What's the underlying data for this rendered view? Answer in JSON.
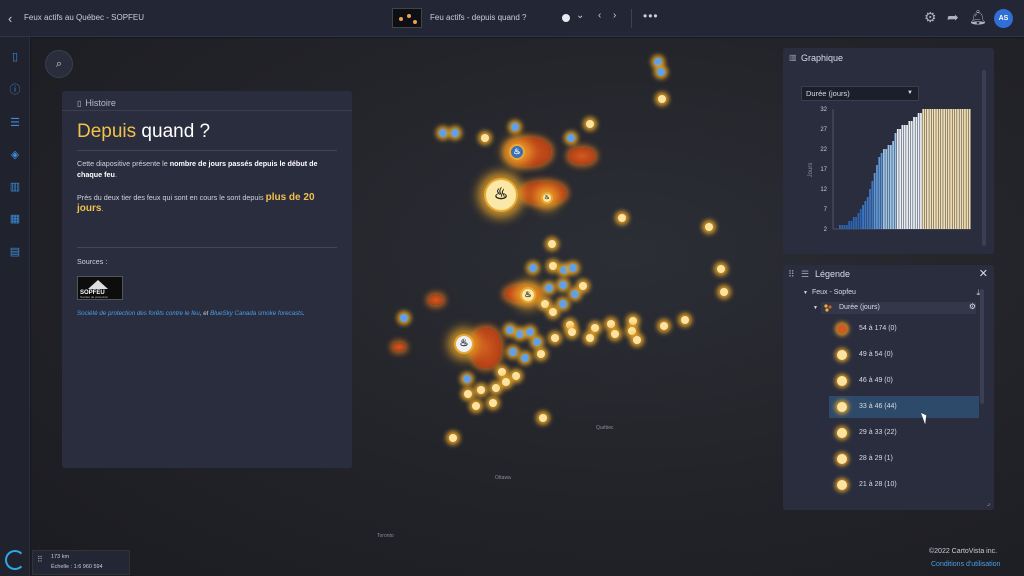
{
  "topbar": {
    "back_icon": "chevron-left-icon",
    "app_title": "Feux actifs au Québec - SOPFEU",
    "slide_title": "Feu actifs - depuis quand ?",
    "more_label": "•••",
    "avatar_initials": "AS"
  },
  "sidebar": {
    "items": [
      "map-icon",
      "info-icon",
      "list-icon",
      "layers-icon",
      "chart-icon",
      "table-icon",
      "book-icon"
    ]
  },
  "story": {
    "header": "Histoire",
    "title_accent": "Depuis",
    "title_rest": " quand ?",
    "p1_a": "Cette diapositive présente le ",
    "p1_b": "nombre de jours passés depuis le début de chaque feu",
    "p1_c": ".",
    "p2_a": "Près du deux tier des feux qui sont en cours le sont depuis ",
    "p2_b": "plus de 20 jours",
    "p2_c": ".",
    "sources_label": "Sources :",
    "logo_text": "SOPFEU",
    "logo_sub": "Société de protection",
    "src_link1": "Société de protection des forêts contre le feu",
    "src_mid": ", et ",
    "src_link2": "BlueSky Canada smoke forecasts",
    "src_end": "."
  },
  "graph": {
    "header": "Graphique",
    "select_value": "Durée (jours)"
  },
  "chart_data": {
    "type": "bar",
    "ylabel": "Jours",
    "ylim": [
      2,
      32
    ],
    "yticks": [
      2,
      7,
      12,
      17,
      22,
      27,
      32
    ],
    "values": [
      3,
      3,
      3,
      3,
      4,
      4,
      5,
      5,
      6,
      7,
      8,
      9,
      10,
      12,
      14,
      16,
      18,
      20,
      21,
      22,
      22,
      23,
      23,
      24,
      26,
      27,
      27,
      28,
      28,
      28,
      29,
      29,
      30,
      30,
      31,
      31,
      32,
      32,
      32,
      32,
      32,
      32,
      32,
      32,
      32,
      32,
      32,
      32,
      32,
      32,
      32,
      32,
      32,
      32,
      32,
      32,
      32
    ],
    "colors": [
      "#2e63b0",
      "#3e76c2",
      "#5f96d4",
      "#9cc4e6",
      "#e8eef4",
      "#f2deae"
    ]
  },
  "legend": {
    "header": "Légende",
    "layer": "Feux - Sopfeu",
    "sublayer": "Durée (jours)",
    "items": [
      {
        "label": "54 à 174 (0)"
      },
      {
        "label": "49 à 54 (0)"
      },
      {
        "label": "46 à 49 (0)"
      },
      {
        "label": "33 à 46 (44)"
      },
      {
        "label": "29 à 33 (22)"
      },
      {
        "label": "28 à 29 (1)"
      },
      {
        "label": "21 à 28 (10)"
      }
    ]
  },
  "map": {
    "labels": {
      "quebec": "Québec",
      "ottawa": "Ottawa",
      "toronto": "Toronto"
    }
  },
  "scale": {
    "distance": "173 km",
    "ratio": "Échelle : 1:6 960 594"
  },
  "attribution": {
    "copyright": "©2022 CartoVista inc.",
    "terms": "Conditions d'utilisation"
  }
}
